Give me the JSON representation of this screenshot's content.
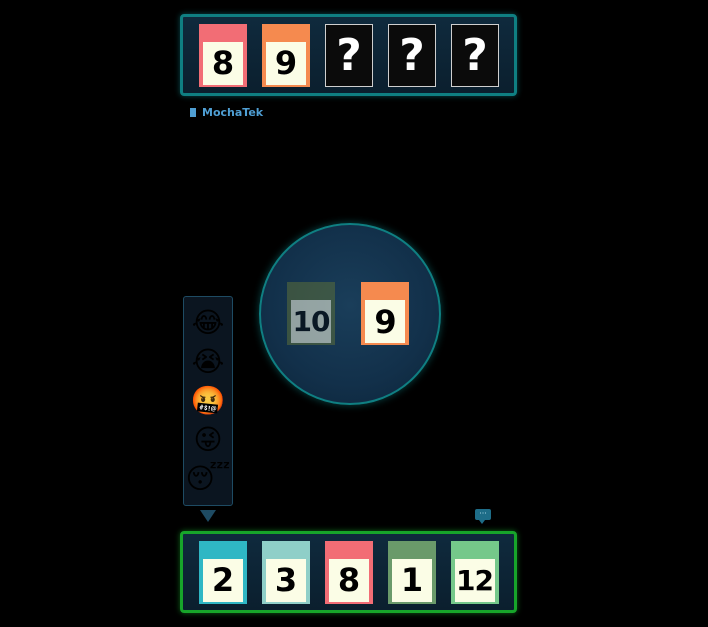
{
  "opponent": {
    "name": "MochaTek",
    "emoji": "😴",
    "hand": [
      {
        "value": "8",
        "color": "#f26d75",
        "hidden": false
      },
      {
        "value": "9",
        "color": "#f58a4f",
        "hidden": false
      },
      {
        "value": "?",
        "hidden": true
      },
      {
        "value": "?",
        "hidden": true
      },
      {
        "value": "?",
        "hidden": true
      }
    ]
  },
  "table": {
    "played": [
      {
        "value": "10",
        "color": "#5b6e3a"
      },
      {
        "value": "9",
        "color": "#f58a4f"
      }
    ]
  },
  "emoji_picker": {
    "emojis": [
      {
        "glyph": "😂",
        "name": "laughing"
      },
      {
        "glyph": "😭",
        "name": "crying"
      },
      {
        "glyph": "🤬",
        "name": "cursing"
      },
      {
        "glyph": "😜",
        "name": "winking-tongue"
      },
      {
        "glyph": "😴",
        "name": "sleeping"
      }
    ]
  },
  "chat": {
    "icon": "chat-bubble-icon",
    "glyph": "···"
  },
  "player": {
    "hand": [
      {
        "value": "2",
        "color": "#2fb7c4"
      },
      {
        "value": "3",
        "color": "#8fcfc8"
      },
      {
        "value": "8",
        "color": "#f26d75"
      },
      {
        "value": "1",
        "color": "#6a9a6a"
      },
      {
        "value": "12",
        "color": "#75c88a"
      }
    ]
  },
  "colors": {
    "opponent_border": "#0f7f82",
    "player_border": "#17a52a",
    "username": "#4f9fd4",
    "card_face": "#fbfde6"
  }
}
